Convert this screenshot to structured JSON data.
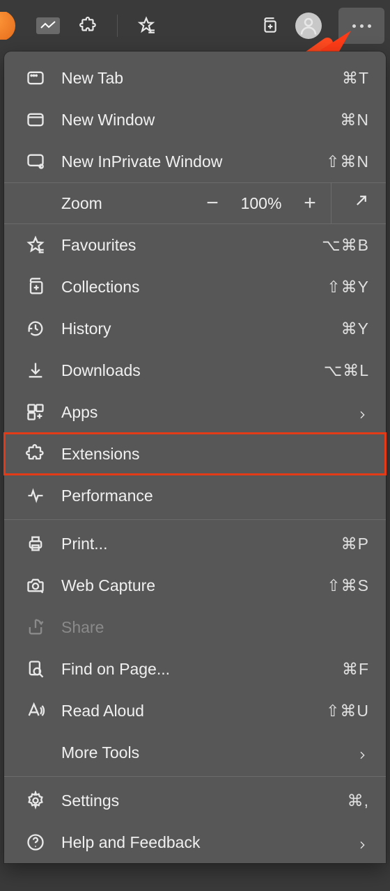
{
  "toolbar": {
    "icons": {
      "analytics": "analytics-icon",
      "extensions": "puzzle-icon",
      "favourites": "star-icon",
      "collections": "collections-icon",
      "profile": "avatar-icon",
      "more": "more-icon"
    }
  },
  "menu": {
    "zoom": {
      "label": "Zoom",
      "value": "100%"
    },
    "items": [
      {
        "label": "New Tab",
        "shortcut": "⌘T"
      },
      {
        "label": "New Window",
        "shortcut": "⌘N"
      },
      {
        "label": "New InPrivate Window",
        "shortcut": "⇧⌘N"
      }
    ],
    "items2": [
      {
        "label": "Favourites",
        "shortcut": "⌥⌘B"
      },
      {
        "label": "Collections",
        "shortcut": "⇧⌘Y"
      },
      {
        "label": "History",
        "shortcut": "⌘Y"
      },
      {
        "label": "Downloads",
        "shortcut": "⌥⌘L"
      },
      {
        "label": "Apps",
        "shortcut": ""
      },
      {
        "label": "Extensions",
        "shortcut": ""
      },
      {
        "label": "Performance",
        "shortcut": ""
      }
    ],
    "items3": [
      {
        "label": "Print...",
        "shortcut": "⌘P"
      },
      {
        "label": "Web Capture",
        "shortcut": "⇧⌘S"
      },
      {
        "label": "Share",
        "shortcut": ""
      },
      {
        "label": "Find on Page...",
        "shortcut": "⌘F"
      },
      {
        "label": "Read Aloud",
        "shortcut": "⇧⌘U"
      },
      {
        "label": "More Tools",
        "shortcut": ""
      }
    ],
    "items4": [
      {
        "label": "Settings",
        "shortcut": "⌘,"
      },
      {
        "label": "Help and Feedback",
        "shortcut": ""
      }
    ]
  },
  "annotation": {
    "highlighted_item": "Extensions",
    "arrow_color": "#e33b17"
  }
}
